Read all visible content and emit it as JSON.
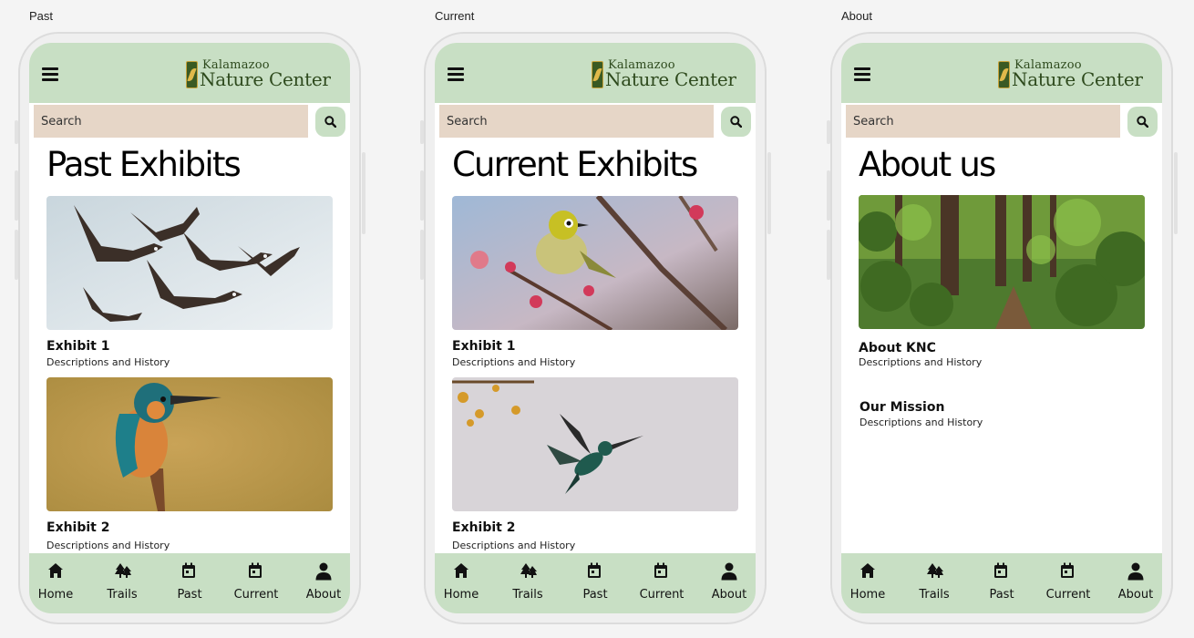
{
  "app": {
    "logo_top": "Kalamazoo",
    "logo_bottom": "Nature Center",
    "search_placeholder": "Search",
    "nav": [
      "Home",
      "Trails",
      "Past",
      "Current",
      "About"
    ]
  },
  "screens": [
    {
      "frame_label": "Past",
      "title": "Past Exhibits",
      "items": [
        {
          "title": "Exhibit 1",
          "desc": "Descriptions and History",
          "image": "flying-geese-photo"
        },
        {
          "title": "Exhibit 2",
          "desc": "Descriptions and History",
          "image": "kingfisher-photo"
        }
      ]
    },
    {
      "frame_label": "Current",
      "title": "Current Exhibits",
      "items": [
        {
          "title": "Exhibit 1",
          "desc": "Descriptions and History",
          "image": "white-eye-bird-photo"
        },
        {
          "title": "Exhibit 2",
          "desc": "Descriptions and History",
          "image": "hummingbird-photo"
        }
      ]
    },
    {
      "frame_label": "About",
      "title": "About us",
      "image": "forest-trail-photo",
      "items": [
        {
          "title": "About KNC",
          "desc": "Descriptions and History"
        },
        {
          "title": "Our Mission",
          "desc": "Descriptions and History"
        }
      ]
    }
  ],
  "colors": {
    "header_green": "#c8dfc4",
    "search_beige": "#e6d6c7",
    "logo_green": "#2e4a1d"
  },
  "icons": [
    "hamburger-menu-icon",
    "search-icon",
    "home-icon",
    "trees-icon",
    "calendar-icon",
    "calendar-check-icon",
    "user-icon"
  ]
}
